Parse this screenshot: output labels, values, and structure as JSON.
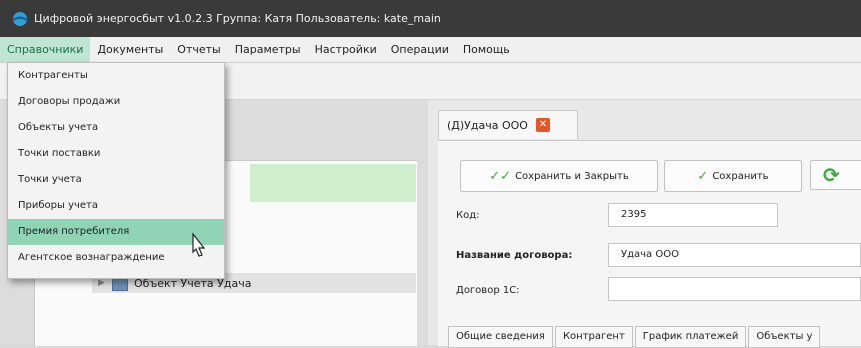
{
  "window": {
    "title": "Цифровой энергосбыт v1.0.2.3 Группа: Катя Пользователь: kate_main",
    "app_icon": "app-logo-icon"
  },
  "menubar": {
    "items": [
      {
        "label": "Справочники",
        "active": true
      },
      {
        "label": "Документы"
      },
      {
        "label": "Отчеты"
      },
      {
        "label": "Параметры"
      },
      {
        "label": "Настройки"
      },
      {
        "label": "Операции"
      },
      {
        "label": "Помощь"
      }
    ]
  },
  "dropdown": {
    "items": [
      {
        "label": "Контрагенты"
      },
      {
        "label": "Договоры продажи"
      },
      {
        "label": "Объекты учета"
      },
      {
        "label": "Точки поставки"
      },
      {
        "label": "Точки учета"
      },
      {
        "label": "Приборы учета"
      },
      {
        "label": "Премия потребителя",
        "hovered": true
      },
      {
        "label": "Агентское вознаграждение"
      }
    ]
  },
  "tree": {
    "row_label": "Объект Учета Удача",
    "row_icon": "building-icon"
  },
  "document_tab": {
    "label": "(Д)Удача ООО",
    "close_icon": "close-icon"
  },
  "toolbar": {
    "save_close_label": "Сохранить и Закрыть",
    "save_label": "Сохранить",
    "refresh_icon": "refresh-icon"
  },
  "form": {
    "code_label": "Код:",
    "code_value": "2395",
    "contract_name_label": "Название договора:",
    "contract_name_value": "Удача ООО",
    "contract_1c_label": "Договор 1С:",
    "contract_1c_value": ""
  },
  "bottom_tabs": [
    {
      "label": "Общие сведения"
    },
    {
      "label": "Контрагент"
    },
    {
      "label": "График платежей"
    },
    {
      "label": "Объекты у"
    }
  ],
  "colors": {
    "title_bar": "#3a3a3a",
    "menu_active": "#bfe6d3",
    "dropdown_hover": "#8fd4b5",
    "tree_selected": "#cfeecc",
    "check_green": "#3bab3b",
    "close_red": "#e2562b"
  }
}
